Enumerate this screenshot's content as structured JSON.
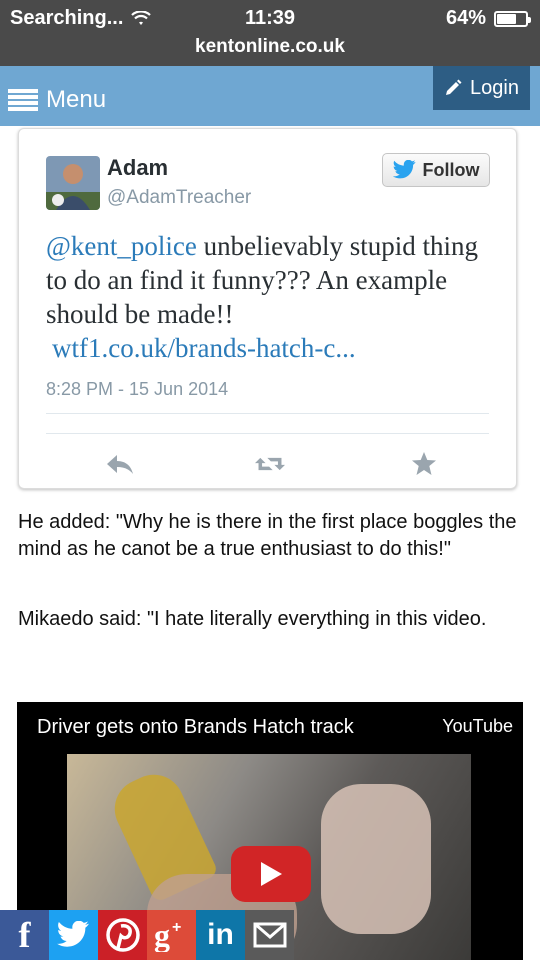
{
  "status_bar": {
    "carrier": "Searching...",
    "time": "11:39",
    "battery": "64%",
    "battery_level": 0.64
  },
  "browser": {
    "url": "kentonline.co.uk"
  },
  "nav": {
    "menu_label": "Menu",
    "login_label": "Login"
  },
  "tweet": {
    "name": "Adam",
    "handle": "@AdamTreacher",
    "follow_label": "Follow",
    "mention": "@kent_police",
    "text": " unbelievably stupid thing to do an find it funny??? An example should be made!!",
    "link": "wtf1.co.uk/brands-hatch-c...",
    "timestamp": "8:28 PM - 15 Jun 2014",
    "actions": [
      "reply-icon",
      "retweet-icon",
      "favorite-icon"
    ]
  },
  "article": {
    "paragraphs": [
      "He added: \"Why he is there in the first place boggles the mind as he canot be a true enthusiast to do this!\"",
      "Mikaedo said: \"I hate literally everything in this video."
    ]
  },
  "video": {
    "title": "Driver gets onto Brands Hatch track",
    "provider": "YouTube"
  },
  "share_bar": [
    {
      "icon": "facebook-icon",
      "glyph": "f",
      "color": "#3b5998"
    },
    {
      "icon": "twitter-icon",
      "glyph": "",
      "color": "#1da1f2"
    },
    {
      "icon": "pinterest-icon",
      "glyph": "",
      "color": "#cb2027"
    },
    {
      "icon": "google-plus-icon",
      "glyph": "",
      "color": "#dd4b39"
    },
    {
      "icon": "linkedin-icon",
      "glyph": "in",
      "color": "#0e76a8"
    },
    {
      "icon": "email-icon",
      "glyph": "",
      "color": "#5a5a5a"
    }
  ]
}
